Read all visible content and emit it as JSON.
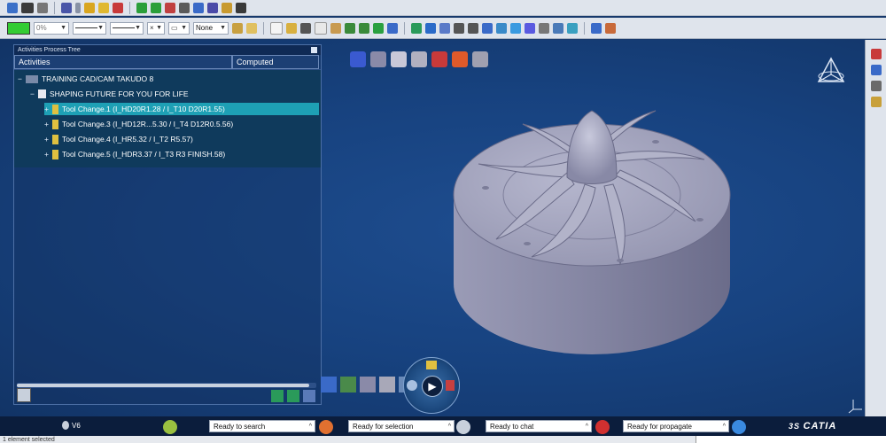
{
  "toolbar": {
    "color_swatch": "#33cc33",
    "transparency_value": "0%",
    "layer_value": "None"
  },
  "tree": {
    "panel_title": "Activities Process Tree",
    "columns": [
      "Activities",
      "Computed"
    ],
    "root": "TRAINING CAD/CAM TAKUDO 8",
    "program": "SHAPING FUTURE FOR YOU FOR LIFE",
    "tool_changes": [
      {
        "label": "Tool Change.1 (I_HD20R1.28 / I_T10 D20R1.55)",
        "selected": true
      },
      {
        "label": "Tool Change.3 (I_HD12R...5.30 / I_T4 D12R0.5.56)",
        "selected": false
      },
      {
        "label": "Tool Change.4 (I_HR5.32 / I_T2 R5.57)",
        "selected": false
      },
      {
        "label": "Tool Change.5 (I_HDR3.37 / I_T3 R3 FINISH.58)",
        "selected": false
      }
    ]
  },
  "status": {
    "search": "Ready to search",
    "selection": "Ready for selection",
    "chat": "Ready to chat",
    "propagate": "Ready for propagate",
    "brand": "CATIA",
    "version": "V6",
    "selected_count": "1 element selected"
  },
  "colors": {
    "viewport_bg": "#17427f",
    "tree_selection": "#1ea0b5",
    "part_surface": "#8d8ea6"
  }
}
